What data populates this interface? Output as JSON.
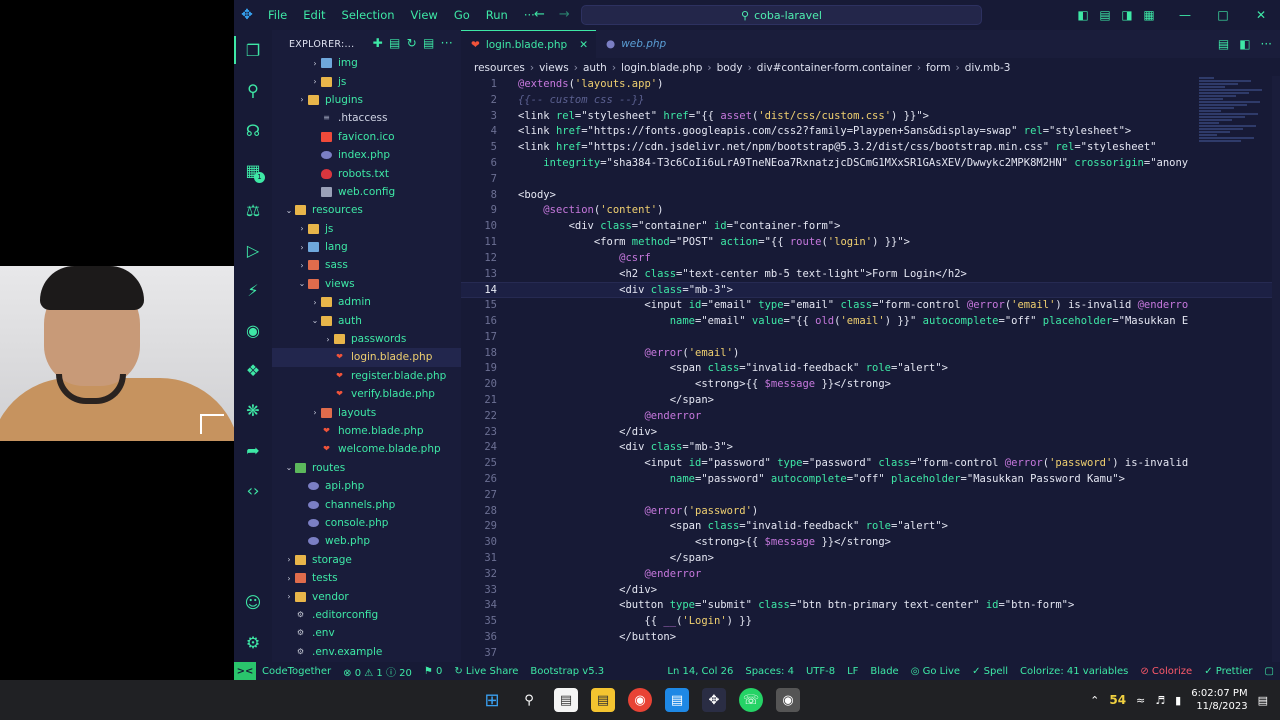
{
  "webcam": {
    "label": "webcam-feed"
  },
  "titlebar": {
    "menu": [
      "File",
      "Edit",
      "Selection",
      "View",
      "Go",
      "Run",
      "···"
    ],
    "search": "coba-laravel"
  },
  "sidebar": {
    "title": "EXPLORER:...",
    "tree": [
      {
        "indent": 3,
        "chev": ">",
        "icon": "folder blue",
        "label": "img"
      },
      {
        "indent": 3,
        "chev": ">",
        "icon": "folder",
        "label": "js"
      },
      {
        "indent": 2,
        "chev": ">",
        "icon": "folder",
        "label": "plugins"
      },
      {
        "indent": 3,
        "chev": "",
        "icon": "ht",
        "label": ".htaccess"
      },
      {
        "indent": 3,
        "chev": "",
        "icon": "star",
        "label": "favicon.ico"
      },
      {
        "indent": 3,
        "chev": "",
        "icon": "php",
        "label": "index.php"
      },
      {
        "indent": 3,
        "chev": "",
        "icon": "ruby",
        "label": "robots.txt"
      },
      {
        "indent": 3,
        "chev": "",
        "icon": "file",
        "label": "web.config"
      },
      {
        "indent": 1,
        "chev": "v",
        "icon": "folder",
        "label": "resources"
      },
      {
        "indent": 2,
        "chev": ">",
        "icon": "folder",
        "label": "js"
      },
      {
        "indent": 2,
        "chev": ">",
        "icon": "folder blue",
        "label": "lang"
      },
      {
        "indent": 2,
        "chev": ">",
        "icon": "folder red",
        "label": "sass"
      },
      {
        "indent": 2,
        "chev": "v",
        "icon": "folder red",
        "label": "views"
      },
      {
        "indent": 3,
        "chev": ">",
        "icon": "folder",
        "label": "admin"
      },
      {
        "indent": 3,
        "chev": "v",
        "icon": "folder",
        "label": "auth"
      },
      {
        "indent": 4,
        "chev": ">",
        "icon": "folder",
        "label": "passwords"
      },
      {
        "indent": 4,
        "chev": "",
        "icon": "blade",
        "label": "login.blade.php",
        "selected": true
      },
      {
        "indent": 4,
        "chev": "",
        "icon": "blade",
        "label": "register.blade.php"
      },
      {
        "indent": 4,
        "chev": "",
        "icon": "blade",
        "label": "verify.blade.php"
      },
      {
        "indent": 3,
        "chev": ">",
        "icon": "folder red",
        "label": "layouts"
      },
      {
        "indent": 3,
        "chev": "",
        "icon": "blade",
        "label": "home.blade.php"
      },
      {
        "indent": 3,
        "chev": "",
        "icon": "blade",
        "label": "welcome.blade.php"
      },
      {
        "indent": 1,
        "chev": "v",
        "icon": "folder green",
        "label": "routes"
      },
      {
        "indent": 2,
        "chev": "",
        "icon": "php",
        "label": "api.php"
      },
      {
        "indent": 2,
        "chev": "",
        "icon": "php",
        "label": "channels.php"
      },
      {
        "indent": 2,
        "chev": "",
        "icon": "php",
        "label": "console.php"
      },
      {
        "indent": 2,
        "chev": "",
        "icon": "php",
        "label": "web.php"
      },
      {
        "indent": 1,
        "chev": ">",
        "icon": "folder",
        "label": "storage"
      },
      {
        "indent": 1,
        "chev": ">",
        "icon": "folder red",
        "label": "tests"
      },
      {
        "indent": 1,
        "chev": ">",
        "icon": "folder",
        "label": "vendor"
      },
      {
        "indent": 1,
        "chev": "",
        "icon": "gear",
        "label": ".editorconfig"
      },
      {
        "indent": 1,
        "chev": "",
        "icon": "gear",
        "label": ".env"
      },
      {
        "indent": 1,
        "chev": "",
        "icon": "gear",
        "label": ".env.example"
      }
    ]
  },
  "tabs": [
    {
      "label": "login.blade.php",
      "active": true
    },
    {
      "label": "web.php",
      "active": false
    }
  ],
  "breadcrumb": [
    "resources",
    "views",
    "auth",
    "login.blade.php",
    "body",
    "div#container-form.container",
    "form",
    "div.mb-3"
  ],
  "editor": {
    "current_line": 14,
    "lines": [
      [
        1,
        [
          [
            "k",
            "@extends"
          ],
          [
            "t",
            "("
          ],
          [
            "q",
            "'layouts.app'"
          ],
          [
            "t",
            ")"
          ]
        ]
      ],
      [
        2,
        [
          [
            "c",
            "{{-- custom css --}}"
          ]
        ]
      ],
      [
        3,
        [
          [
            "t",
            "<link "
          ],
          [
            "a",
            "rel"
          ],
          [
            "t",
            "=\"stylesheet\" "
          ],
          [
            "a",
            "href"
          ],
          [
            "t",
            "=\"{{ "
          ],
          [
            "k",
            "asset"
          ],
          [
            "t",
            "("
          ],
          [
            "q",
            "'dist/css/custom.css'"
          ],
          [
            "t",
            ") }}\">"
          ]
        ]
      ],
      [
        4,
        [
          [
            "t",
            "<link "
          ],
          [
            "a",
            "href"
          ],
          [
            "t",
            "=\"https://fonts.googleapis.com/css2?family=Playpen+Sans&display=swap\" "
          ],
          [
            "a",
            "rel"
          ],
          [
            "t",
            "=\"stylesheet\">"
          ]
        ]
      ],
      [
        5,
        [
          [
            "t",
            "<link "
          ],
          [
            "a",
            "href"
          ],
          [
            "t",
            "=\"https://cdn.jsdelivr.net/npm/bootstrap@5.3.2/dist/css/bootstrap.min.css\" "
          ],
          [
            "a",
            "rel"
          ],
          [
            "t",
            "=\"stylesheet\""
          ]
        ]
      ],
      [
        6,
        [
          [
            "t",
            "    "
          ],
          [
            "a",
            "integrity"
          ],
          [
            "t",
            "=\"sha384-T3c6CoIi6uLrA9TneNEoa7RxnatzjcDSCmG1MXxSR1GAsXEV/Dwwykc2MPK8M2HN\" "
          ],
          [
            "a",
            "crossorigin"
          ],
          [
            "t",
            "=\"anony"
          ]
        ]
      ],
      [
        7,
        []
      ],
      [
        8,
        [
          [
            "t",
            "<body>"
          ]
        ]
      ],
      [
        9,
        [
          [
            "t",
            "    "
          ],
          [
            "k",
            "@section"
          ],
          [
            "t",
            "("
          ],
          [
            "q",
            "'content'"
          ],
          [
            "t",
            ")"
          ]
        ]
      ],
      [
        10,
        [
          [
            "t",
            "        <div "
          ],
          [
            "a",
            "class"
          ],
          [
            "t",
            "=\"container\" "
          ],
          [
            "a",
            "id"
          ],
          [
            "t",
            "=\"container-form\">"
          ]
        ]
      ],
      [
        11,
        [
          [
            "t",
            "            <form "
          ],
          [
            "a",
            "method"
          ],
          [
            "t",
            "=\"POST\" "
          ],
          [
            "a",
            "action"
          ],
          [
            "t",
            "=\"{{ "
          ],
          [
            "k",
            "route"
          ],
          [
            "t",
            "("
          ],
          [
            "q",
            "'login'"
          ],
          [
            "t",
            ") }}\">"
          ]
        ]
      ],
      [
        12,
        [
          [
            "t",
            "                "
          ],
          [
            "k",
            "@csrf"
          ]
        ]
      ],
      [
        13,
        [
          [
            "t",
            "                <h2 "
          ],
          [
            "a",
            "class"
          ],
          [
            "t",
            "=\"text-center mb-5 text-light\">Form Login</h2>"
          ]
        ]
      ],
      [
        14,
        [
          [
            "t",
            "                <div "
          ],
          [
            "a",
            "class"
          ],
          [
            "t",
            "=\"mb-3\">"
          ]
        ]
      ],
      [
        15,
        [
          [
            "t",
            "                    <input "
          ],
          [
            "a",
            "id"
          ],
          [
            "t",
            "=\"email\" "
          ],
          [
            "a",
            "type"
          ],
          [
            "t",
            "=\"email\" "
          ],
          [
            "a",
            "class"
          ],
          [
            "t",
            "=\"form-control "
          ],
          [
            "k",
            "@error"
          ],
          [
            "t",
            "("
          ],
          [
            "q",
            "'email'"
          ],
          [
            "t",
            ") is-invalid "
          ],
          [
            "k",
            "@enderro"
          ]
        ]
      ],
      [
        16,
        [
          [
            "t",
            "                        "
          ],
          [
            "a",
            "name"
          ],
          [
            "t",
            "=\"email\" "
          ],
          [
            "a",
            "value"
          ],
          [
            "t",
            "=\"{{ "
          ],
          [
            "k",
            "old"
          ],
          [
            "t",
            "("
          ],
          [
            "q",
            "'email'"
          ],
          [
            "t",
            ") }}\" "
          ],
          [
            "a",
            "autocomplete"
          ],
          [
            "t",
            "=\"off\" "
          ],
          [
            "a",
            "placeholder"
          ],
          [
            "t",
            "=\"Masukkan E"
          ]
        ]
      ],
      [
        17,
        []
      ],
      [
        18,
        [
          [
            "t",
            "                    "
          ],
          [
            "k",
            "@error"
          ],
          [
            "t",
            "("
          ],
          [
            "q",
            "'email'"
          ],
          [
            "t",
            ")"
          ]
        ]
      ],
      [
        19,
        [
          [
            "t",
            "                        <span "
          ],
          [
            "a",
            "class"
          ],
          [
            "t",
            "=\"invalid-feedback\" "
          ],
          [
            "a",
            "role"
          ],
          [
            "t",
            "=\"alert\">"
          ]
        ]
      ],
      [
        20,
        [
          [
            "t",
            "                            <strong>{{ "
          ],
          [
            "k",
            "$message"
          ],
          [
            "t",
            " }}</strong>"
          ]
        ]
      ],
      [
        21,
        [
          [
            "t",
            "                        </span>"
          ]
        ]
      ],
      [
        22,
        [
          [
            "t",
            "                    "
          ],
          [
            "k",
            "@enderror"
          ]
        ]
      ],
      [
        23,
        [
          [
            "t",
            "                </div>"
          ]
        ]
      ],
      [
        24,
        [
          [
            "t",
            "                <div "
          ],
          [
            "a",
            "class"
          ],
          [
            "t",
            "=\"mb-3\">"
          ]
        ]
      ],
      [
        25,
        [
          [
            "t",
            "                    <input "
          ],
          [
            "a",
            "id"
          ],
          [
            "t",
            "=\"password\" "
          ],
          [
            "a",
            "type"
          ],
          [
            "t",
            "=\"password\" "
          ],
          [
            "a",
            "class"
          ],
          [
            "t",
            "=\"form-control "
          ],
          [
            "k",
            "@error"
          ],
          [
            "t",
            "("
          ],
          [
            "q",
            "'password'"
          ],
          [
            "t",
            ") is-invalid"
          ]
        ]
      ],
      [
        26,
        [
          [
            "t",
            "                        "
          ],
          [
            "a",
            "name"
          ],
          [
            "t",
            "=\"password\" "
          ],
          [
            "a",
            "autocomplete"
          ],
          [
            "t",
            "=\"off\" "
          ],
          [
            "a",
            "placeholder"
          ],
          [
            "t",
            "=\"Masukkan Password Kamu\">"
          ]
        ]
      ],
      [
        27,
        []
      ],
      [
        28,
        [
          [
            "t",
            "                    "
          ],
          [
            "k",
            "@error"
          ],
          [
            "t",
            "("
          ],
          [
            "q",
            "'password'"
          ],
          [
            "t",
            ")"
          ]
        ]
      ],
      [
        29,
        [
          [
            "t",
            "                        <span "
          ],
          [
            "a",
            "class"
          ],
          [
            "t",
            "=\"invalid-feedback\" "
          ],
          [
            "a",
            "role"
          ],
          [
            "t",
            "=\"alert\">"
          ]
        ]
      ],
      [
        30,
        [
          [
            "t",
            "                            <strong>{{ "
          ],
          [
            "k",
            "$message"
          ],
          [
            "t",
            " }}</strong>"
          ]
        ]
      ],
      [
        31,
        [
          [
            "t",
            "                        </span>"
          ]
        ]
      ],
      [
        32,
        [
          [
            "t",
            "                    "
          ],
          [
            "k",
            "@enderror"
          ]
        ]
      ],
      [
        33,
        [
          [
            "t",
            "                </div>"
          ]
        ]
      ],
      [
        34,
        [
          [
            "t",
            "                <button "
          ],
          [
            "a",
            "type"
          ],
          [
            "t",
            "=\"submit\" "
          ],
          [
            "a",
            "class"
          ],
          [
            "t",
            "=\"btn btn-primary text-center\" "
          ],
          [
            "a",
            "id"
          ],
          [
            "t",
            "=\"btn-form\">"
          ]
        ]
      ],
      [
        35,
        [
          [
            "t",
            "                    {{ "
          ],
          [
            "k",
            "__"
          ],
          [
            "t",
            "("
          ],
          [
            "q",
            "'Login'"
          ],
          [
            "t",
            ") }}"
          ]
        ]
      ],
      [
        36,
        [
          [
            "t",
            "                </button>"
          ]
        ]
      ],
      [
        37,
        []
      ]
    ]
  },
  "statusbar": {
    "remote": "><",
    "items_left": [
      "CodeTogether",
      "⊗ 0 ⚠ 1 ⓘ 20",
      "⚑ 0",
      "↻ Live Share",
      "Bootstrap v5.3"
    ],
    "items_right": [
      "Ln 14, Col 26",
      "Spaces: 4",
      "UTF-8",
      "LF",
      "Blade",
      "◎ Go Live",
      "✓ Spell",
      "Colorize: 41 variables",
      "⊘ Colorize",
      "✓ Prettier",
      "▢"
    ]
  },
  "taskbar": {
    "battery": "54",
    "time": "6:02:07 PM",
    "date": "11/8/2023"
  }
}
